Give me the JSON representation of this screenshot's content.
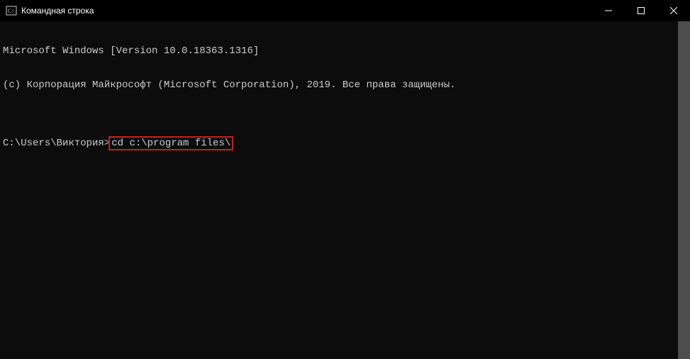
{
  "window": {
    "title": "Командная строка"
  },
  "terminal": {
    "line1": "Microsoft Windows [Version 10.0.18363.1316]",
    "line2": "(c) Корпорация Майкрософт (Microsoft Corporation), 2019. Все права защищены.",
    "blank": "",
    "prompt": "C:\\Users\\Виктория>",
    "command": "cd c:\\program files\\"
  },
  "highlight": {
    "color": "#c52020"
  }
}
